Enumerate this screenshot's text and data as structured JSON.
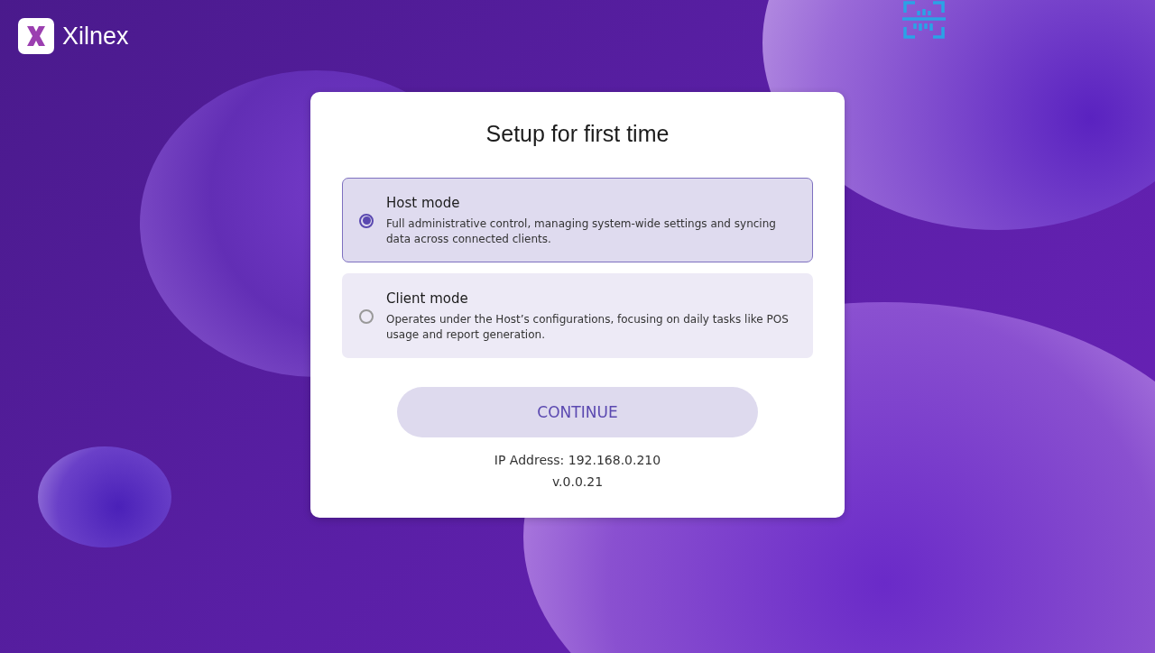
{
  "brand": {
    "name": "Xilnex"
  },
  "dialog": {
    "title": "Setup for first time",
    "options": [
      {
        "label": "Host mode",
        "description": "Full administrative control, managing system-wide settings and syncing data across connected clients.",
        "selected": true
      },
      {
        "label": "Client mode",
        "description": "Operates under the Host’s configurations, focusing on daily tasks like POS usage and report generation.",
        "selected": false
      }
    ],
    "button": "CONTINUE",
    "ip_address": "IP Address: 192.168.0.210",
    "version": "v.0.0.21"
  }
}
